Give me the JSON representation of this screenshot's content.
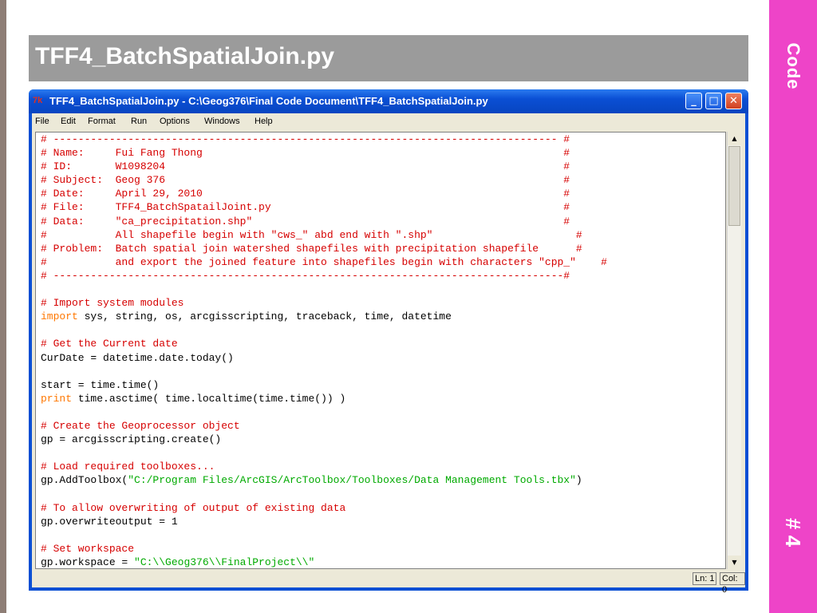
{
  "slide": {
    "title": "TFF4_BatchSpatialJoin.py",
    "side_label": "Code",
    "side_number": "# 4",
    "accent_color": "#ee44c8"
  },
  "window": {
    "title": "TFF4_BatchSpatialJoin.py - C:\\Geog376\\Final Code Document\\TFF4_BatchSpatialJoin.py",
    "app_icon": "idle-icon",
    "buttons": {
      "minimize": "minimize-icon",
      "maximize": "maximize-icon",
      "close": "close-icon"
    }
  },
  "menu": [
    "File",
    "Edit",
    "Format",
    "Run",
    "Options",
    "Windows",
    "Help"
  ],
  "code_lines": [
    "# --------------------------------------------------------------------------------- #",
    "# Name:     Fui Fang Thong                                                          #",
    "# ID:       W1098204                                                                #",
    "# Subject:  Geog 376                                                                #",
    "# Date:     April 29, 2010                                                          #",
    "# File:     TFF4_BatchSpatailJoint.py                                               #",
    "# Data:     \"ca_precipitation.shp\"                                                  #",
    "#           All shapefile begin with \"cws_\" abd end with \".shp\"                       #",
    "# Problem:  Batch spatial join watershed shapefiles with precipitation shapefile      #",
    "#           and export the joined feature into shapefiles begin with characters \"cpp_\"    #",
    "# ----------------------------------------------------------------------------------#",
    "",
    "# Import system modules",
    "import sys, string, os, arcgisscripting, traceback, time, datetime",
    "",
    "# Get the Current date",
    "CurDate = datetime.date.today()",
    "",
    "start = time.time()",
    "print time.asctime( time.localtime(time.time()) )",
    "",
    "# Create the Geoprocessor object",
    "gp = arcgisscripting.create()",
    "",
    "# Load required toolboxes...",
    "gp.AddToolbox(\"C:/Program Files/ArcGIS/ArcToolbox/Toolboxes/Data Management Tools.tbx\")",
    "",
    "# To allow overwriting of output of existing data",
    "gp.overwriteoutput = 1",
    "",
    "# Set workspace",
    "gp.workspace = \"C:\\\\Geog376\\\\FinalProject\\\\\""
  ],
  "status": {
    "line": "Ln: 1",
    "col": "Col: 0"
  }
}
